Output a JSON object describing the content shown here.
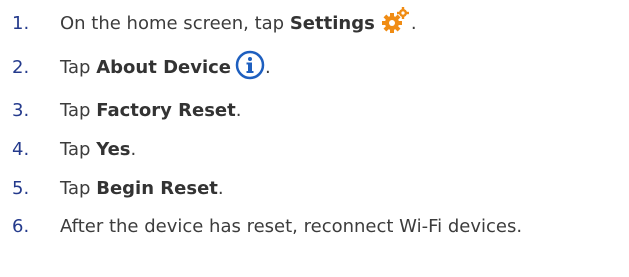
{
  "steps": [
    {
      "num": "1.",
      "pre": "On the home screen, tap ",
      "bold": "Settings",
      "post": " .",
      "icon": "settings-gears-icon"
    },
    {
      "num": "2.",
      "pre": "Tap ",
      "bold": "About Device",
      "post": ".",
      "icon": "info-icon"
    },
    {
      "num": "3.",
      "pre": "Tap ",
      "bold": "Factory Reset",
      "post": "."
    },
    {
      "num": "4.",
      "pre": "Tap ",
      "bold": "Yes",
      "post": "."
    },
    {
      "num": "5.",
      "pre": "Tap ",
      "bold": "Begin Reset",
      "post": "."
    },
    {
      "num": "6.",
      "text": "After the device has reset, reconnect Wi-Fi devices."
    }
  ],
  "colors": {
    "number": "#243a8c",
    "info_icon": "#1e5fbf",
    "gear_icon": "#f08c14"
  }
}
